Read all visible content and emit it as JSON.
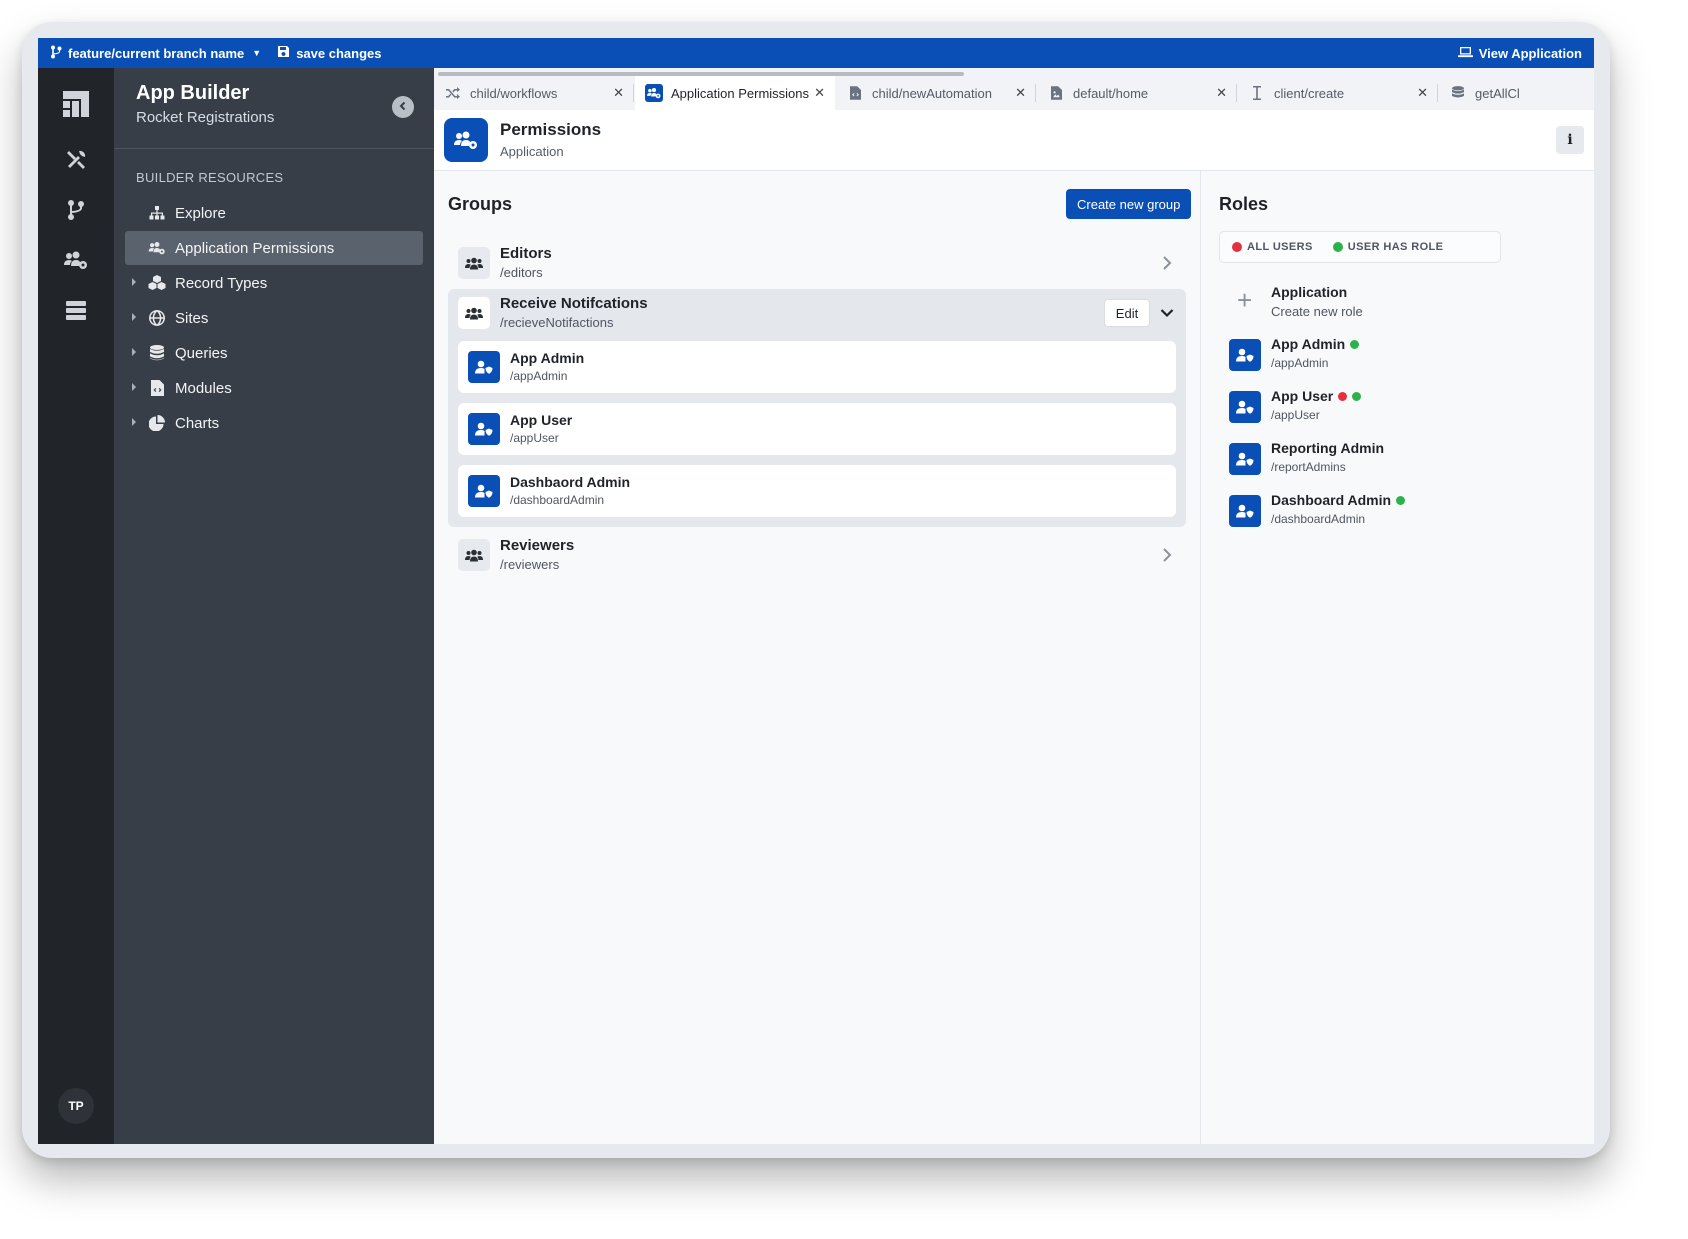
{
  "topbar": {
    "branch": "feature/current branch name",
    "save": "save changes",
    "view": "View Application",
    "color": "#0a4fb5"
  },
  "rail": {
    "icons": [
      "logo-icon",
      "tools-icon",
      "branch-icon",
      "users-cog-icon",
      "server-icon"
    ],
    "avatar": "TP"
  },
  "sidebar": {
    "title": "App Builder",
    "subtitle": "Rocket Registrations",
    "section": "BUILDER RESOURCES",
    "items": [
      {
        "label": "Explore",
        "icon": "sitemap-icon",
        "expandable": false,
        "active": false
      },
      {
        "label": "Application Permissions",
        "icon": "users-cog-icon",
        "expandable": false,
        "active": true
      },
      {
        "label": "Record Types",
        "icon": "cubes-icon",
        "expandable": true,
        "active": false
      },
      {
        "label": "Sites",
        "icon": "globe-icon",
        "expandable": true,
        "active": false
      },
      {
        "label": "Queries",
        "icon": "database-icon",
        "expandable": true,
        "active": false
      },
      {
        "label": "Modules",
        "icon": "file-code-icon",
        "expandable": true,
        "active": false
      },
      {
        "label": "Charts",
        "icon": "pie-chart-icon",
        "expandable": true,
        "active": false
      }
    ]
  },
  "tabs": [
    {
      "label": "child/workflows",
      "icon": "shuffle-icon",
      "active": false
    },
    {
      "label": "Application Permissions",
      "icon": "users-cog-icon",
      "active": true
    },
    {
      "label": "child/newAutomation",
      "icon": "file-code-icon",
      "active": false
    },
    {
      "label": "default/home",
      "icon": "file-image-icon",
      "active": false
    },
    {
      "label": "client/create",
      "icon": "text-cursor-icon",
      "active": false
    },
    {
      "label": "getAllCl",
      "icon": "database-icon",
      "active": false
    }
  ],
  "header": {
    "title": "Permissions",
    "subtitle": "Application",
    "info": "i"
  },
  "groups": {
    "title": "Groups",
    "create_label": "Create new group",
    "items": [
      {
        "name": "Editors",
        "path": "/editors"
      },
      {
        "name": "Receive Notifcations",
        "path": "/recieveNotifactions",
        "edit_label": "Edit",
        "roles": [
          {
            "name": "App Admin",
            "path": "/appAdmin"
          },
          {
            "name": "App User",
            "path": "/appUser"
          },
          {
            "name": "Dashbaord Admin",
            "path": "/dashboardAdmin"
          }
        ]
      },
      {
        "name": "Reviewers",
        "path": "/reviewers"
      }
    ]
  },
  "roles": {
    "title": "Roles",
    "legend": {
      "all_users": "ALL USERS",
      "user_has_role": "USER HAS ROLE"
    },
    "create": {
      "name": "Application",
      "sub": "Create new role"
    },
    "items": [
      {
        "name": "App Admin",
        "path": "/appAdmin",
        "all_users": false,
        "user_has_role": true
      },
      {
        "name": "App User",
        "path": "/appUser",
        "all_users": true,
        "user_has_role": true
      },
      {
        "name": "Reporting Admin",
        "path": "/reportAdmins",
        "all_users": false,
        "user_has_role": false
      },
      {
        "name": "Dashboard Admin",
        "path": "/dashboardAdmin",
        "all_users": false,
        "user_has_role": true
      }
    ]
  },
  "colors": {
    "accent": "#0a4fb5",
    "red": "#e5303e",
    "green": "#2cb24a"
  }
}
